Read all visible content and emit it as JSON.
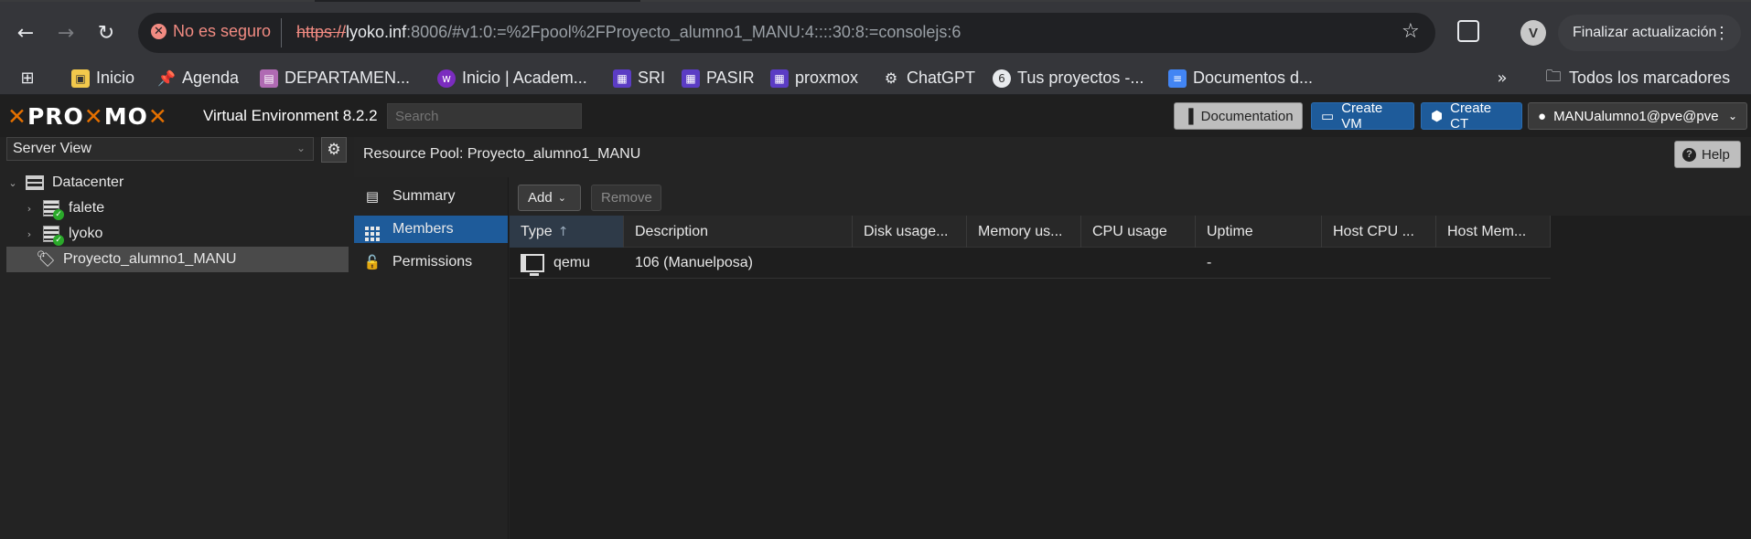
{
  "browser": {
    "security_label": "No es seguro",
    "url_scheme": "https://",
    "url_host": "lyoko.inf",
    "url_rest": ":8006/#v1:0:=%2Fpool%2FProyecto_alumno1_MANU:4::::30:8:=consolejs:6",
    "update_label": "Finalizar actualización",
    "bookmarks": [
      {
        "label": "Inicio",
        "icon": "image-icon",
        "color": "#f2c94c"
      },
      {
        "label": "Agenda",
        "icon": "pin-icon",
        "color": "#ea4335"
      },
      {
        "label": "DEPARTAMEN...",
        "icon": "site-icon",
        "color": "#b06ab3"
      },
      {
        "label": "Inicio | Academ...",
        "icon": "w-icon",
        "color": "#7b2cbf"
      },
      {
        "label": "SRI",
        "icon": "form-icon",
        "color": "#5b3cc4"
      },
      {
        "label": "PASIR",
        "icon": "form-icon",
        "color": "#5b3cc4"
      },
      {
        "label": "proxmox",
        "icon": "form-icon",
        "color": "#5b3cc4"
      },
      {
        "label": "ChatGPT",
        "icon": "openai-icon",
        "color": "#e8eaed"
      },
      {
        "label": "Tus proyectos -...",
        "icon": "swirl-icon",
        "color": "#e8eaed"
      },
      {
        "label": "Documentos d...",
        "icon": "docs-icon",
        "color": "#4285f4"
      }
    ],
    "all_bookmarks_label": "Todos los marcadores"
  },
  "pve": {
    "version_label": "Virtual Environment 8.2.2",
    "search_placeholder": "Search",
    "documentation_label": "Documentation",
    "create_vm_label": "Create VM",
    "create_ct_label": "Create CT",
    "user_label": "MANUalumno1@pve@pve"
  },
  "tree": {
    "view_label": "Server View",
    "nodes": [
      {
        "label": "Datacenter"
      },
      {
        "label": "falete"
      },
      {
        "label": "lyoko"
      },
      {
        "label": "Proyecto_alumno1_MANU"
      }
    ]
  },
  "content": {
    "title": "Resource Pool: Proyecto_alumno1_MANU",
    "help_label": "Help",
    "nav": [
      {
        "label": "Summary"
      },
      {
        "label": "Members"
      },
      {
        "label": "Permissions"
      }
    ],
    "add_label": "Add",
    "remove_label": "Remove",
    "columns": [
      "Type",
      "Description",
      "Disk usage...",
      "Memory us...",
      "CPU usage",
      "Uptime",
      "Host CPU ...",
      "Host Mem..."
    ],
    "rows": [
      {
        "type": "qemu",
        "description": "106 (Manuelposa)",
        "disk": "",
        "memory": "",
        "cpu": "",
        "uptime": "-",
        "host_cpu": "",
        "host_mem": ""
      }
    ]
  }
}
